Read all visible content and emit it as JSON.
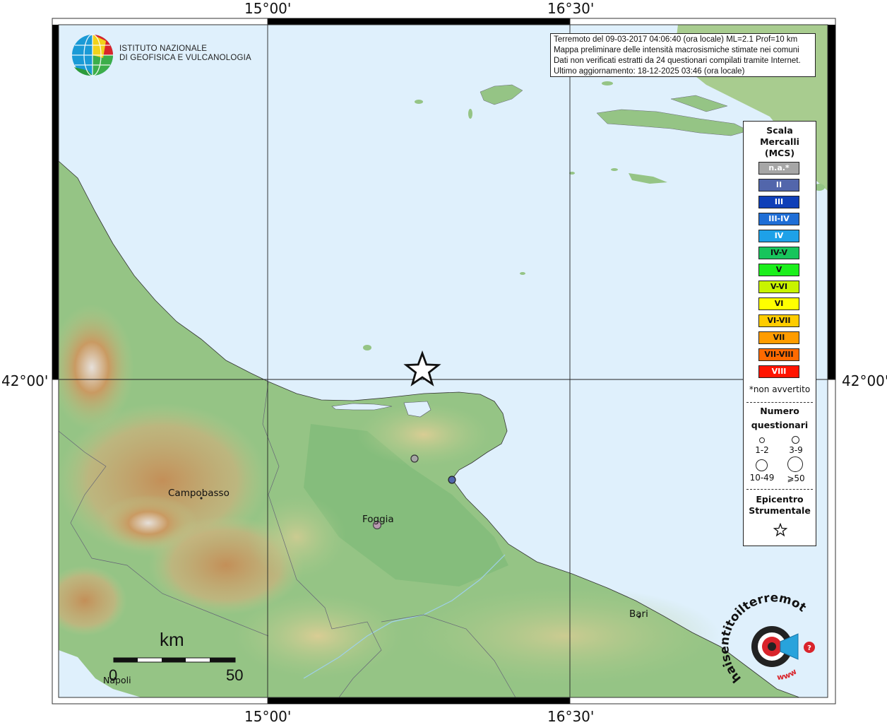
{
  "logo": {
    "line1": "ISTITUTO NAZIONALE",
    "line2": "DI GEOFISICA E VULCANOLOGIA",
    "icon": "ingv-globe-icon"
  },
  "info": {
    "line1": "Terremoto del 09-03-2017 04:06:40 (ora locale) ML=2.1 Prof=10 km",
    "line2": "Mappa preliminare delle intensità macrosismiche stimate nei comuni",
    "line3": "Dati non verificati estratti da 24 questionari compilati tramite Internet.",
    "line4": "Ultimo aggiornamento: 18-12-2025 03:46 (ora locale)"
  },
  "grid": {
    "lon_labels": [
      "15°00'",
      "16°30'"
    ],
    "lat_labels": [
      "42°00'",
      "42°00'"
    ]
  },
  "legend": {
    "title_lines": [
      "Scala",
      "Mercalli",
      "(MCS)"
    ],
    "scale": [
      {
        "label": "n.a.*",
        "color": "#a6a6a6",
        "text_color": "#ffffff"
      },
      {
        "label": "II",
        "color": "#5266ab",
        "text_color": "#ffffff"
      },
      {
        "label": "III",
        "color": "#0f3fb8",
        "text_color": "#ffffff"
      },
      {
        "label": "III-IV",
        "color": "#1f6ed6",
        "text_color": "#ffffff"
      },
      {
        "label": "IV",
        "color": "#1ea1e8",
        "text_color": "#ffffff"
      },
      {
        "label": "IV-V",
        "color": "#17c55c",
        "text_color": "#111111"
      },
      {
        "label": "V",
        "color": "#1bef1b",
        "text_color": "#111111"
      },
      {
        "label": "V-VI",
        "color": "#c8f400",
        "text_color": "#111111"
      },
      {
        "label": "VI",
        "color": "#ffff00",
        "text_color": "#111111"
      },
      {
        "label": "VI-VII",
        "color": "#ffcc00",
        "text_color": "#111111"
      },
      {
        "label": "VII",
        "color": "#ff9c00",
        "text_color": "#111111"
      },
      {
        "label": "VII-VIII",
        "color": "#ff6a00",
        "text_color": "#111111"
      },
      {
        "label": "VIII",
        "color": "#ff1400",
        "text_color": "#ffffff"
      }
    ],
    "na_note": "*non avvertito",
    "count_title_1": "Numero",
    "count_title_2": "questionari",
    "count_labels": [
      "1-2",
      "3-9",
      "10-49",
      "⩾50"
    ],
    "epicenter_title_1": "Epicentro",
    "epicenter_title_2": "Strumentale",
    "epicenter_icon": "star-icon"
  },
  "cities": [
    "Campobasso",
    "Foggia",
    "Bari",
    "Napoli"
  ],
  "scale_bar": {
    "unit": "km",
    "min": "0",
    "max": "50"
  },
  "observations": [
    {
      "intensity": "n.a.*",
      "color": "#a6a6a6"
    },
    {
      "intensity": "II",
      "color": "#5266ab"
    },
    {
      "intensity": "n.a.*",
      "color": "#b89ab0"
    }
  ],
  "brand": {
    "text": "haisentitoilterremoto.it",
    "sub": "www",
    "icon": "haisentito-logo-icon"
  },
  "colors": {
    "sea": "#dff0fc",
    "land_low": "#8fc283",
    "land_mid": "#c9d9a0",
    "land_high": "#d4b27a",
    "mountain": "#b98a56"
  }
}
